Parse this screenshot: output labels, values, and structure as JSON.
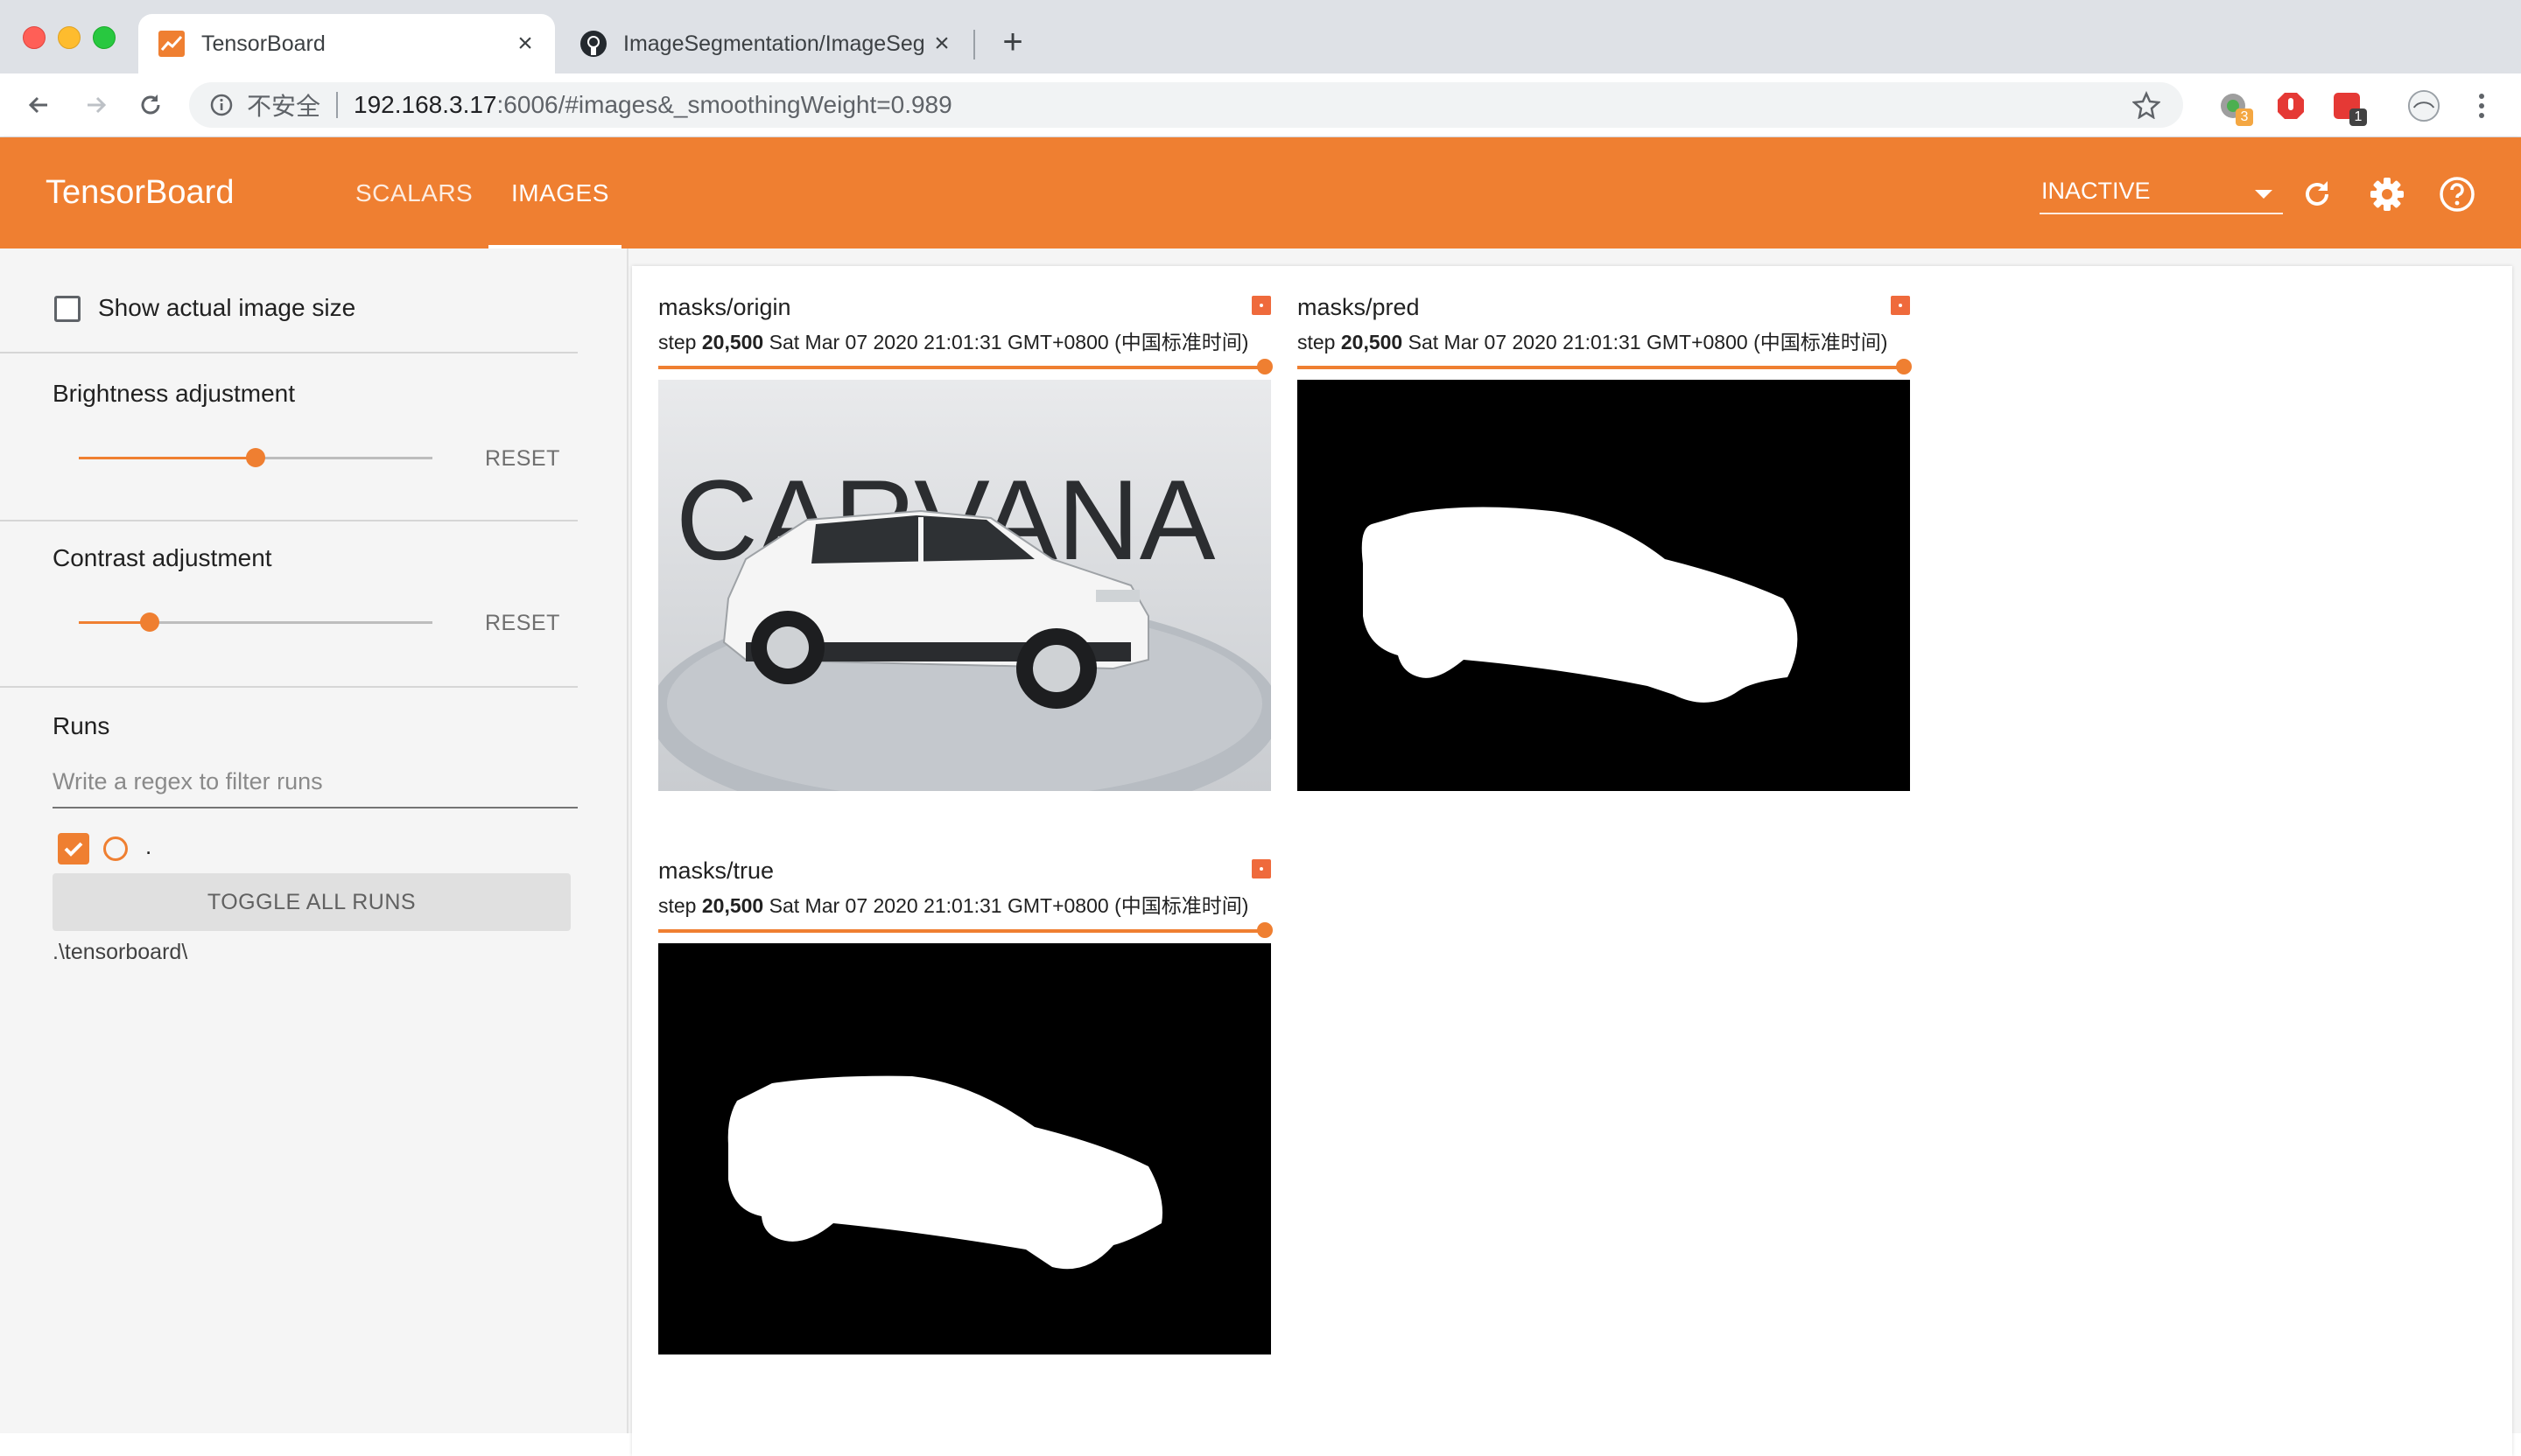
{
  "browser": {
    "tabs": [
      {
        "title": "TensorBoard",
        "favicon": "tensorboard-favicon",
        "active": true
      },
      {
        "title": "ImageSegmentation/ImageSegm",
        "favicon": "github-icon",
        "active": false
      }
    ],
    "omnibox": {
      "security_label": "不安全",
      "url_host": "192.168.3.17",
      "url_rest": ":6006/#images&_smoothingWeight=0.989"
    },
    "extensions": [
      {
        "name": "extension-badge-3",
        "badge": "3"
      },
      {
        "name": "adblock-extension",
        "badge": ""
      },
      {
        "name": "extension-badge-1",
        "badge": "1"
      },
      {
        "name": "profile-avatar",
        "badge": ""
      }
    ]
  },
  "tensorboard": {
    "brand": "TensorBoard",
    "tabs": [
      "SCALARS",
      "IMAGES"
    ],
    "active_tab": "IMAGES",
    "run_selector": "INACTIVE",
    "accent_color": "#ef7f31"
  },
  "sidebar": {
    "show_actual_size": "Show actual image size",
    "brightness": {
      "label": "Brightness adjustment",
      "reset": "RESET",
      "value": 0.5
    },
    "contrast": {
      "label": "Contrast adjustment",
      "reset": "RESET",
      "value": 0.2
    },
    "runs": {
      "title": "Runs",
      "filter_placeholder": "Write a regex to filter runs",
      "run_name": ".",
      "toggle_all": "TOGGLE ALL RUNS",
      "logdir": ".\\tensorboard\\"
    }
  },
  "cards": [
    {
      "tag": "masks/origin",
      "step_label": "step",
      "step": "20,500",
      "time": "Sat Mar 07 2020 21:01:31 GMT+0800 (中国标准时间)",
      "kind": "photo",
      "brand_text": "CARVANA"
    },
    {
      "tag": "masks/pred",
      "step_label": "step",
      "step": "20,500",
      "time": "Sat Mar 07 2020 21:01:31 GMT+0800 (中国标准时间)",
      "kind": "mask"
    },
    {
      "tag": "masks/true",
      "step_label": "step",
      "step": "20,500",
      "time": "Sat Mar 07 2020 21:01:31 GMT+0800 (中国标准时间)",
      "kind": "mask"
    }
  ]
}
